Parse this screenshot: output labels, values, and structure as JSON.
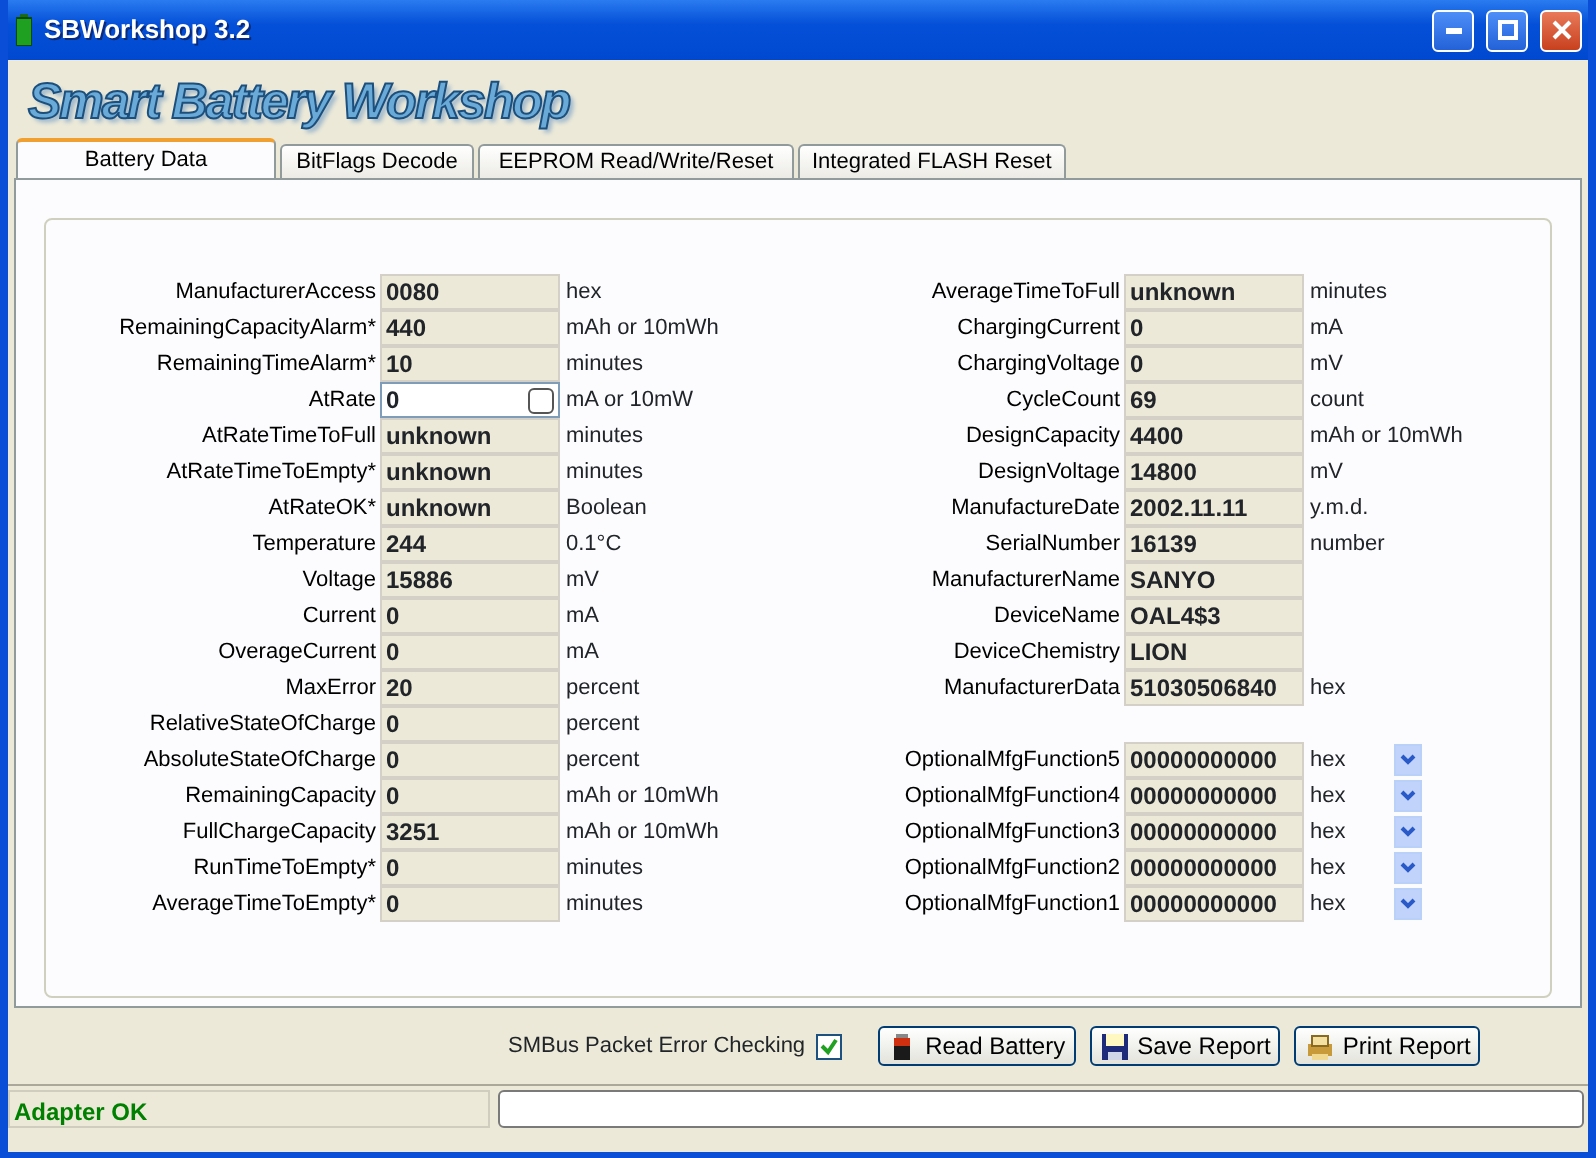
{
  "window": {
    "title": "SBWorkshop 3.2"
  },
  "logo": "Smart Battery Workshop",
  "tabs": [
    {
      "label": "Battery Data",
      "selected": true
    },
    {
      "label": "BitFlags Decode",
      "selected": false
    },
    {
      "label": "EEPROM Read/Write/Reset",
      "selected": false
    },
    {
      "label": "Integrated FLASH Reset",
      "selected": false
    }
  ],
  "left_fields": [
    {
      "label": "ManufacturerAccess",
      "value": "0080",
      "unit": "hex",
      "editable": false
    },
    {
      "label": "RemainingCapacityAlarm*",
      "value": "440",
      "unit": "mAh or 10mWh",
      "editable": false
    },
    {
      "label": "RemainingTimeAlarm*",
      "value": "10",
      "unit": "minutes",
      "editable": false
    },
    {
      "label": "AtRate",
      "value": "0",
      "unit": "mA or 10mW",
      "editable": true
    },
    {
      "label": "AtRateTimeToFull",
      "value": "unknown",
      "unit": "minutes",
      "editable": false
    },
    {
      "label": "AtRateTimeToEmpty*",
      "value": "unknown",
      "unit": "minutes",
      "editable": false
    },
    {
      "label": "AtRateOK*",
      "value": "unknown",
      "unit": "Boolean",
      "editable": false
    },
    {
      "label": "Temperature",
      "value": "244",
      "unit": "0.1°C",
      "editable": false
    },
    {
      "label": "Voltage",
      "value": "15886",
      "unit": "mV",
      "editable": false
    },
    {
      "label": "Current",
      "value": "0",
      "unit": "mA",
      "editable": false
    },
    {
      "label": "OverageCurrent",
      "value": "0",
      "unit": "mA",
      "editable": false
    },
    {
      "label": "MaxError",
      "value": "20",
      "unit": "percent",
      "editable": false
    },
    {
      "label": "RelativeStateOfCharge",
      "value": "0",
      "unit": "percent",
      "editable": false
    },
    {
      "label": "AbsoluteStateOfCharge",
      "value": "0",
      "unit": "percent",
      "editable": false
    },
    {
      "label": "RemainingCapacity",
      "value": "0",
      "unit": "mAh or 10mWh",
      "editable": false
    },
    {
      "label": "FullChargeCapacity",
      "value": "3251",
      "unit": "mAh or 10mWh",
      "editable": false
    },
    {
      "label": "RunTimeToEmpty*",
      "value": "0",
      "unit": "minutes",
      "editable": false
    },
    {
      "label": "AverageTimeToEmpty*",
      "value": "0",
      "unit": "minutes",
      "editable": false
    }
  ],
  "right_fields": [
    {
      "label": "AverageTimeToFull",
      "value": "unknown",
      "unit": "minutes"
    },
    {
      "label": "ChargingCurrent",
      "value": "0",
      "unit": "mA"
    },
    {
      "label": "ChargingVoltage",
      "value": "0",
      "unit": "mV"
    },
    {
      "label": "CycleCount",
      "value": "69",
      "unit": "count"
    },
    {
      "label": "DesignCapacity",
      "value": "4400",
      "unit": "mAh or 10mWh"
    },
    {
      "label": "DesignVoltage",
      "value": "14800",
      "unit": "mV"
    },
    {
      "label": "ManufactureDate",
      "value": "2002.11.11",
      "unit": "y.m.d."
    },
    {
      "label": "SerialNumber",
      "value": "16139",
      "unit": "number"
    },
    {
      "label": "ManufacturerName",
      "value": "SANYO"
    },
    {
      "label": "DeviceName",
      "value": "OAL4$3"
    },
    {
      "label": "DeviceChemistry",
      "value": "LION"
    },
    {
      "label": "ManufacturerData",
      "value": "51030506840",
      "unit": "hex"
    }
  ],
  "optional_functions": [
    {
      "label": "OptionalMfgFunction5",
      "value": "00000000000",
      "unit": "hex"
    },
    {
      "label": "OptionalMfgFunction4",
      "value": "00000000000",
      "unit": "hex"
    },
    {
      "label": "OptionalMfgFunction3",
      "value": "00000000000",
      "unit": "hex"
    },
    {
      "label": "OptionalMfgFunction2",
      "value": "00000000000",
      "unit": "hex"
    },
    {
      "label": "OptionalMfgFunction1",
      "value": "00000000000",
      "unit": "hex"
    }
  ],
  "pec": {
    "label": "SMBus Packet Error Checking",
    "checked": true
  },
  "buttons": [
    {
      "label": "Read Battery",
      "kind": "read"
    },
    {
      "label": "Save Report",
      "kind": "save"
    },
    {
      "label": "Print Report",
      "kind": "print"
    }
  ],
  "status_bar": {
    "status": "Adapter OK"
  }
}
